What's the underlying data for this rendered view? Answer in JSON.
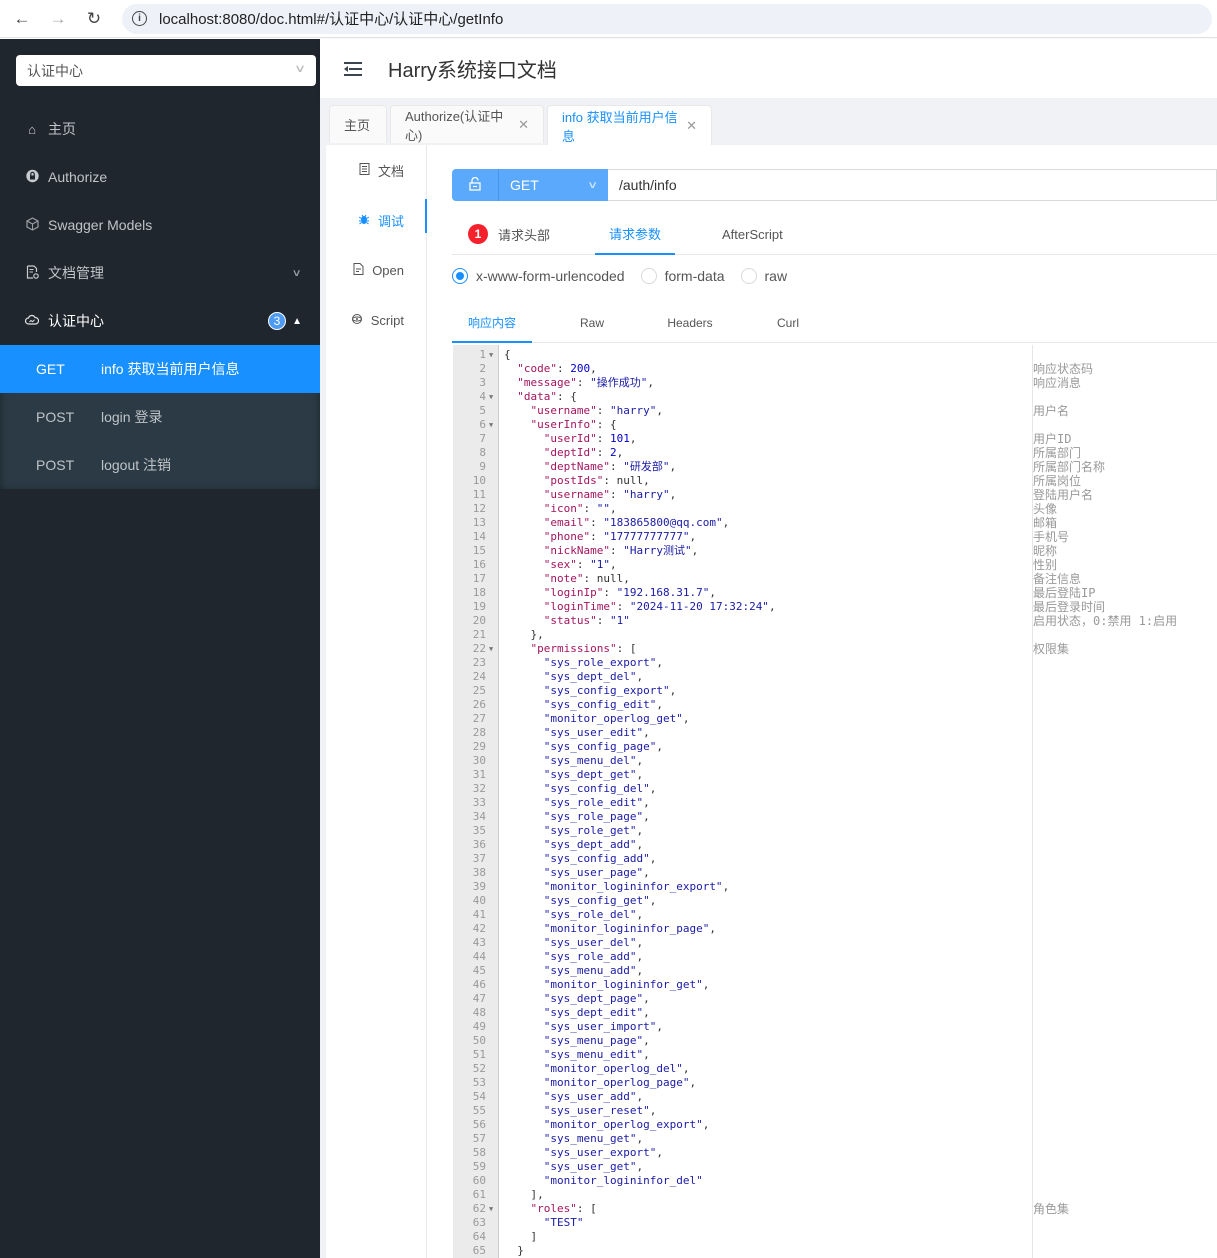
{
  "browser": {
    "url": "localhost:8080/doc.html#/认证中心/认证中心/getInfo",
    "back_icon": "arrow-left-icon",
    "forward_icon": "arrow-right-icon",
    "reload_icon": "reload-icon",
    "info_icon": "info-icon"
  },
  "sidebar": {
    "group_select": "认证中心",
    "items": [
      {
        "label": "主页",
        "icon": "home-icon"
      },
      {
        "label": "Authorize",
        "icon": "lock-icon"
      },
      {
        "label": "Swagger Models",
        "icon": "cube-icon"
      },
      {
        "label": "文档管理",
        "icon": "document-settings-icon",
        "expanded": false
      },
      {
        "label": "认证中心",
        "icon": "cloud-icon",
        "badge": "3",
        "expanded": true
      }
    ],
    "sub_items": [
      {
        "method": "GET",
        "label": "info 获取当前用户信息",
        "active": true
      },
      {
        "method": "POST",
        "label": "login 登录",
        "active": false
      },
      {
        "method": "POST",
        "label": "logout 注销",
        "active": false
      }
    ]
  },
  "header": {
    "title": "Harry系统接口文档"
  },
  "tabs": [
    {
      "label": "主页",
      "closable": false
    },
    {
      "label": "Authorize(认证中心)",
      "closable": true
    },
    {
      "label": "info 获取当前用户信息",
      "closable": true,
      "active": true
    }
  ],
  "side_tabs": [
    {
      "label": "文档",
      "icon": "document-icon"
    },
    {
      "label": "调试",
      "icon": "bug-icon",
      "active": true
    },
    {
      "label": "Open",
      "icon": "file-icon"
    },
    {
      "label": "Script",
      "icon": "script-icon"
    }
  ],
  "request": {
    "method": "GET",
    "path": "/auth/info"
  },
  "param_tabs": [
    {
      "label": "请求头部",
      "badge": "1"
    },
    {
      "label": "请求参数",
      "active": true
    },
    {
      "label": "AfterScript"
    }
  ],
  "content_types": [
    {
      "label": "x-www-form-urlencoded",
      "checked": true
    },
    {
      "label": "form-data",
      "checked": false
    },
    {
      "label": "raw",
      "checked": false
    }
  ],
  "response_tabs": [
    {
      "label": "响应内容",
      "active": true
    },
    {
      "label": "Raw"
    },
    {
      "label": "Headers"
    },
    {
      "label": "Curl"
    }
  ],
  "response": {
    "code": 200,
    "message": "操作成功",
    "data": {
      "username": "harry",
      "userInfo": {
        "userId": 101,
        "deptId": 2,
        "deptName": "研发部",
        "postIds": null,
        "username": "harry",
        "icon": "",
        "email": "183865800@qq.com",
        "phone": "17777777777",
        "nickName": "Harry测试",
        "sex": "1",
        "note": null,
        "loginIp": "192.168.31.7",
        "loginTime": "2024-11-20 17:32:24",
        "status": "1"
      },
      "permissions": [
        "sys_role_export",
        "sys_dept_del",
        "sys_config_export",
        "sys_config_edit",
        "monitor_operlog_get",
        "sys_user_edit",
        "sys_config_page",
        "sys_menu_del",
        "sys_dept_get",
        "sys_config_del",
        "sys_role_edit",
        "sys_role_page",
        "sys_role_get",
        "sys_dept_add",
        "sys_config_add",
        "sys_user_page",
        "monitor_logininfor_export",
        "sys_config_get",
        "sys_role_del",
        "monitor_logininfor_page",
        "sys_user_del",
        "sys_role_add",
        "sys_menu_add",
        "monitor_logininfor_get",
        "sys_dept_page",
        "sys_dept_edit",
        "sys_user_import",
        "sys_menu_page",
        "sys_menu_edit",
        "monitor_operlog_del",
        "monitor_operlog_page",
        "sys_user_add",
        "sys_user_reset",
        "monitor_operlog_export",
        "sys_menu_get",
        "sys_user_export",
        "sys_user_get",
        "monitor_logininfor_del"
      ],
      "roles": [
        "TEST"
      ]
    }
  },
  "comments": {
    "code": "响应状态码",
    "message": "响应消息",
    "username": "用户名",
    "userId": "用户ID",
    "deptId": "所属部门",
    "deptName": "所属部门名称",
    "postIds": "所属岗位",
    "userInfo.username": "登陆用户名",
    "icon": "头像",
    "email": "邮箱",
    "phone": "手机号",
    "nickName": "昵称",
    "sex": "性别",
    "note": "备注信息",
    "loginIp": "最后登陆IP",
    "loginTime": "最后登录时间",
    "status": "启用状态，0:禁用 1:启用",
    "permissions": "权限集",
    "roles": "角色集"
  }
}
